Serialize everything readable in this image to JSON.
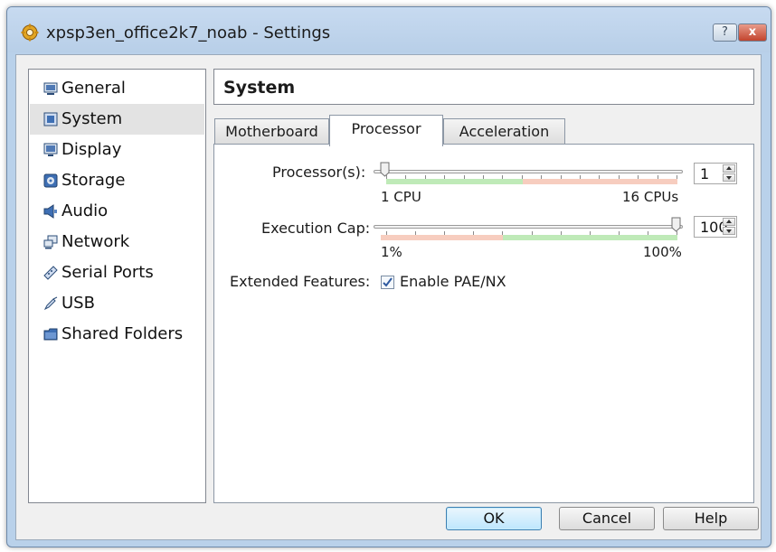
{
  "window": {
    "title": "xpsp3en_office2k7_noab - Settings",
    "help_label": "?",
    "close_label": "x"
  },
  "sidebar": {
    "items": [
      {
        "label": "General",
        "icon": "monitor-icon"
      },
      {
        "label": "System",
        "icon": "chip-icon",
        "selected": true
      },
      {
        "label": "Display",
        "icon": "display-icon"
      },
      {
        "label": "Storage",
        "icon": "storage-icon"
      },
      {
        "label": "Audio",
        "icon": "speaker-icon"
      },
      {
        "label": "Network",
        "icon": "network-icon"
      },
      {
        "label": "Serial Ports",
        "icon": "serial-port-icon"
      },
      {
        "label": "USB",
        "icon": "usb-icon"
      },
      {
        "label": "Shared Folders",
        "icon": "folder-icon"
      }
    ]
  },
  "header": {
    "title": "System"
  },
  "tabs": [
    {
      "label": "Motherboard",
      "active": false
    },
    {
      "label": "Processor",
      "active": true
    },
    {
      "label": "Acceleration",
      "active": false
    }
  ],
  "processor": {
    "processors_label": "Processor(s):",
    "processors_value": "1",
    "processors_min_label": "1 CPU",
    "processors_max_label": "16 CPUs",
    "exec_cap_label": "Execution Cap:",
    "exec_cap_value": "100",
    "exec_cap_min_label": "1%",
    "exec_cap_max_label": "100%",
    "extended_features_label": "Extended Features:",
    "pae_label": "Enable PAE/NX",
    "pae_checked": true
  },
  "buttons": {
    "ok": "OK",
    "cancel": "Cancel",
    "help": "Help"
  },
  "colors": {
    "range_good": "#bfeab8",
    "range_bad": "#f7cdbf",
    "accent": "#3c7fb1"
  }
}
